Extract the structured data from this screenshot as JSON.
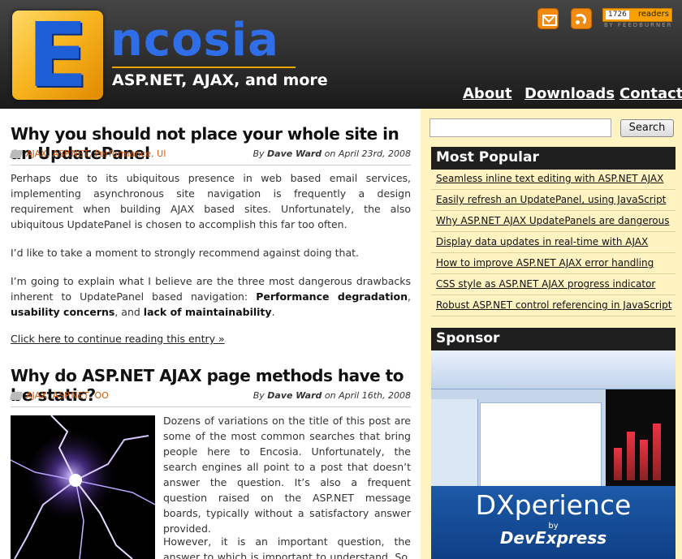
{
  "header": {
    "logo_letter": "E",
    "logo_text": "ncosia",
    "tagline": "ASP.NET, AJAX, and more",
    "feedburner_count": "1726",
    "feedburner_label": "readers",
    "feedburner_by": "BY FEEDBURNER",
    "nav": [
      "About",
      "Downloads",
      "Contact"
    ]
  },
  "posts": [
    {
      "title": "Why you should not place your whole site in an UpdatePanel",
      "tags": "AJAX, ASP.NET, Performance, UI",
      "byline_by": "By",
      "author": "Dave Ward",
      "byline_on": "on April 23rd, 2008",
      "p1": "Perhaps due to its ubiquitous presence in web based email services, implementing asynchronous site navigation is frequently a design requirement when building AJAX based sites. Unfortunately, the also ubiquitous UpdatePanel is chosen to accomplish this far too often.",
      "p2": "I’d like to take a moment to strongly recommend against doing that.",
      "p3_start": "I’m going to explain what I believe are the three most dangerous drawbacks inherent to UpdatePanel based navigation: ",
      "p3_b1": "Performance degradation",
      "p3_sep1": ", ",
      "p3_b2": "usability concerns",
      "p3_sep2": ", and ",
      "p3_b3": "lack of maintainability",
      "p3_end": ".",
      "read_more": "Click here to continue reading this entry »"
    },
    {
      "title": "Why do ASP.NET AJAX page methods have to be static?",
      "tags": "AJAX, ASP.NET, OO",
      "byline_by": "By",
      "author": "Dave Ward",
      "byline_on": "on April 16th, 2008",
      "p1": "Dozens of variations on the title of this post are some of the most common searches that bring people here to Encosia. Unfortunately, the search engines all point to a post that doesn’t answer the question. It’s also a frequent question raised on the ASP.NET message boards, typically without a satisfactory answer provided.",
      "p2": "However, it is an important question, the answer to which is important to understand. So, in an"
    }
  ],
  "sidebar": {
    "search_button": "Search",
    "popular_heading": "Most Popular",
    "popular": [
      "Seamless inline text editing with ASP.NET AJAX",
      "Easily refresh an UpdatePanel, using JavaScript",
      "Why ASP.NET AJAX UpdatePanels are dangerous",
      "Display data updates in real-time with AJAX",
      "How to improve ASP.NET AJAX error handling",
      "CSS style as ASP.NET AJAX progress indicator",
      "Robust ASP.NET control referencing in JavaScript"
    ],
    "sponsor_heading": "Sponsor",
    "sponsor_product": "DXperience",
    "sponsor_by": "by",
    "sponsor_company": "DevExpress"
  },
  "colors": {
    "header_bg": "#2a2a2a",
    "logo_blue": "#2f6ee6",
    "logo_orange": "#f7b21c",
    "tag_orange": "#d25a0b",
    "sidebar_bg": "#fff3c2"
  }
}
